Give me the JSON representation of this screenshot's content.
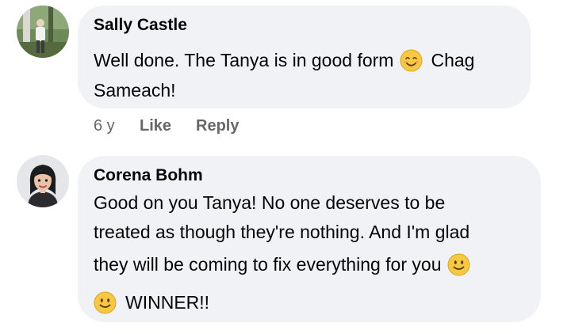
{
  "comments": [
    {
      "author": "Sally Castle",
      "text_line1_a": "Well done. The Tanya is in good form",
      "text_line1_emoji": "smiling-face-with-smiling-eyes-icon",
      "text_line1_b": "Chag",
      "text_line2": "Sameach!",
      "timestamp": "6 y",
      "like_label": "Like",
      "reply_label": "Reply"
    },
    {
      "author": "Corena Bohm",
      "text_line1": "Good on you Tanya! No one deserves to be",
      "text_line2": "treated as though they're nothing. And I'm glad",
      "text_line3": "they will be coming to fix everything for you",
      "text_line3_emoji": "slightly-smiling-face-icon",
      "text_line4_emoji": "slightly-smiling-face-icon",
      "text_line4": "WINNER!!"
    }
  ],
  "colors": {
    "bubble_bg": "#f0f2f5",
    "text": "#050505",
    "meta_text": "#65676b",
    "emoji_yellow": "#f7c843"
  }
}
